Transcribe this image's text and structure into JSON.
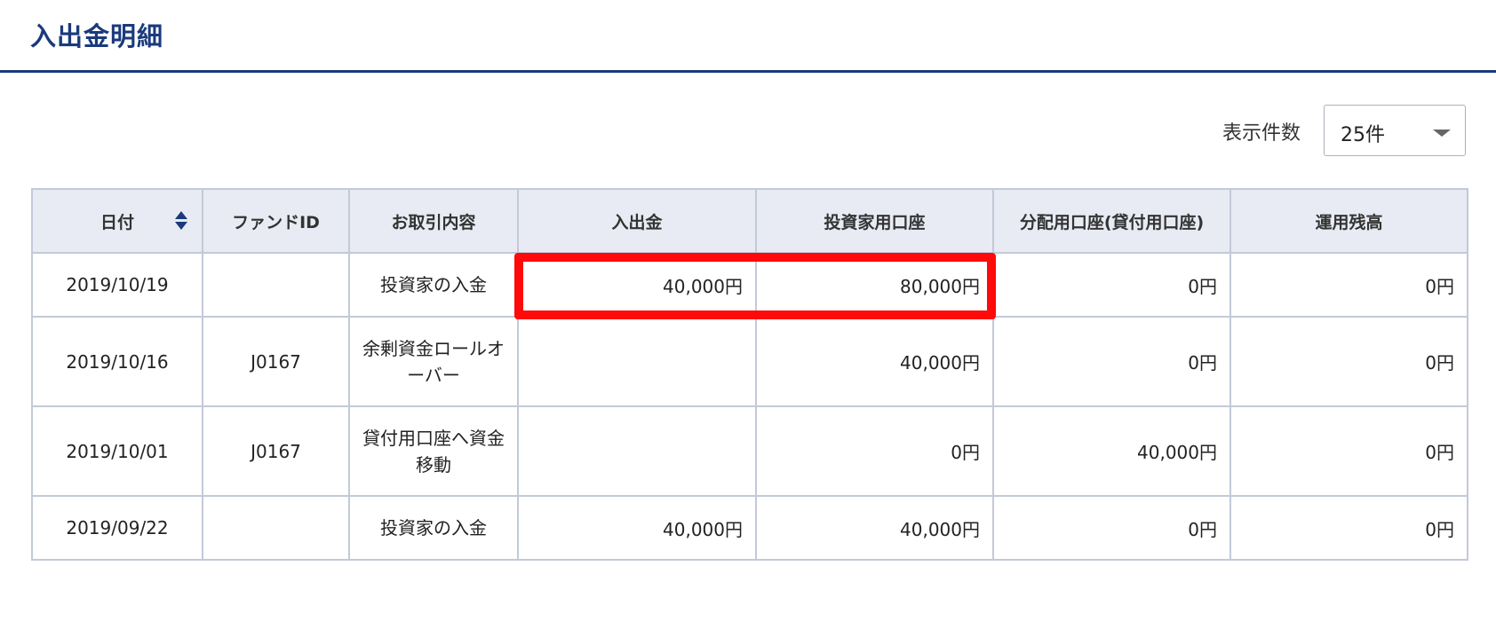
{
  "page": {
    "title": "入出金明細"
  },
  "display_count": {
    "label": "表示件数",
    "selected": "25件"
  },
  "table": {
    "headers": [
      "日付",
      "ファンドID",
      "お取引内容",
      "入出金",
      "投資家用口座",
      "分配用口座(貸付用口座)",
      "運用残高"
    ],
    "rows": [
      {
        "date": "2019/10/19",
        "fund_id": "",
        "description": "投資家の入金",
        "deposit": "40,000円",
        "investor_account": "80,000円",
        "distribution_account": "0円",
        "balance": "0円"
      },
      {
        "date": "2019/10/16",
        "fund_id": "J0167",
        "description": "余剰資金ロールオーバー",
        "deposit": "",
        "investor_account": "40,000円",
        "distribution_account": "0円",
        "balance": "0円"
      },
      {
        "date": "2019/10/01",
        "fund_id": "J0167",
        "description": "貸付用口座へ資金移動",
        "deposit": "",
        "investor_account": "0円",
        "distribution_account": "40,000円",
        "balance": "0円"
      },
      {
        "date": "2019/09/22",
        "fund_id": "",
        "description": "投資家の入金",
        "deposit": "40,000円",
        "investor_account": "40,000円",
        "distribution_account": "0円",
        "balance": "0円"
      }
    ]
  },
  "annotation": {
    "color": "#ff0a0a"
  }
}
